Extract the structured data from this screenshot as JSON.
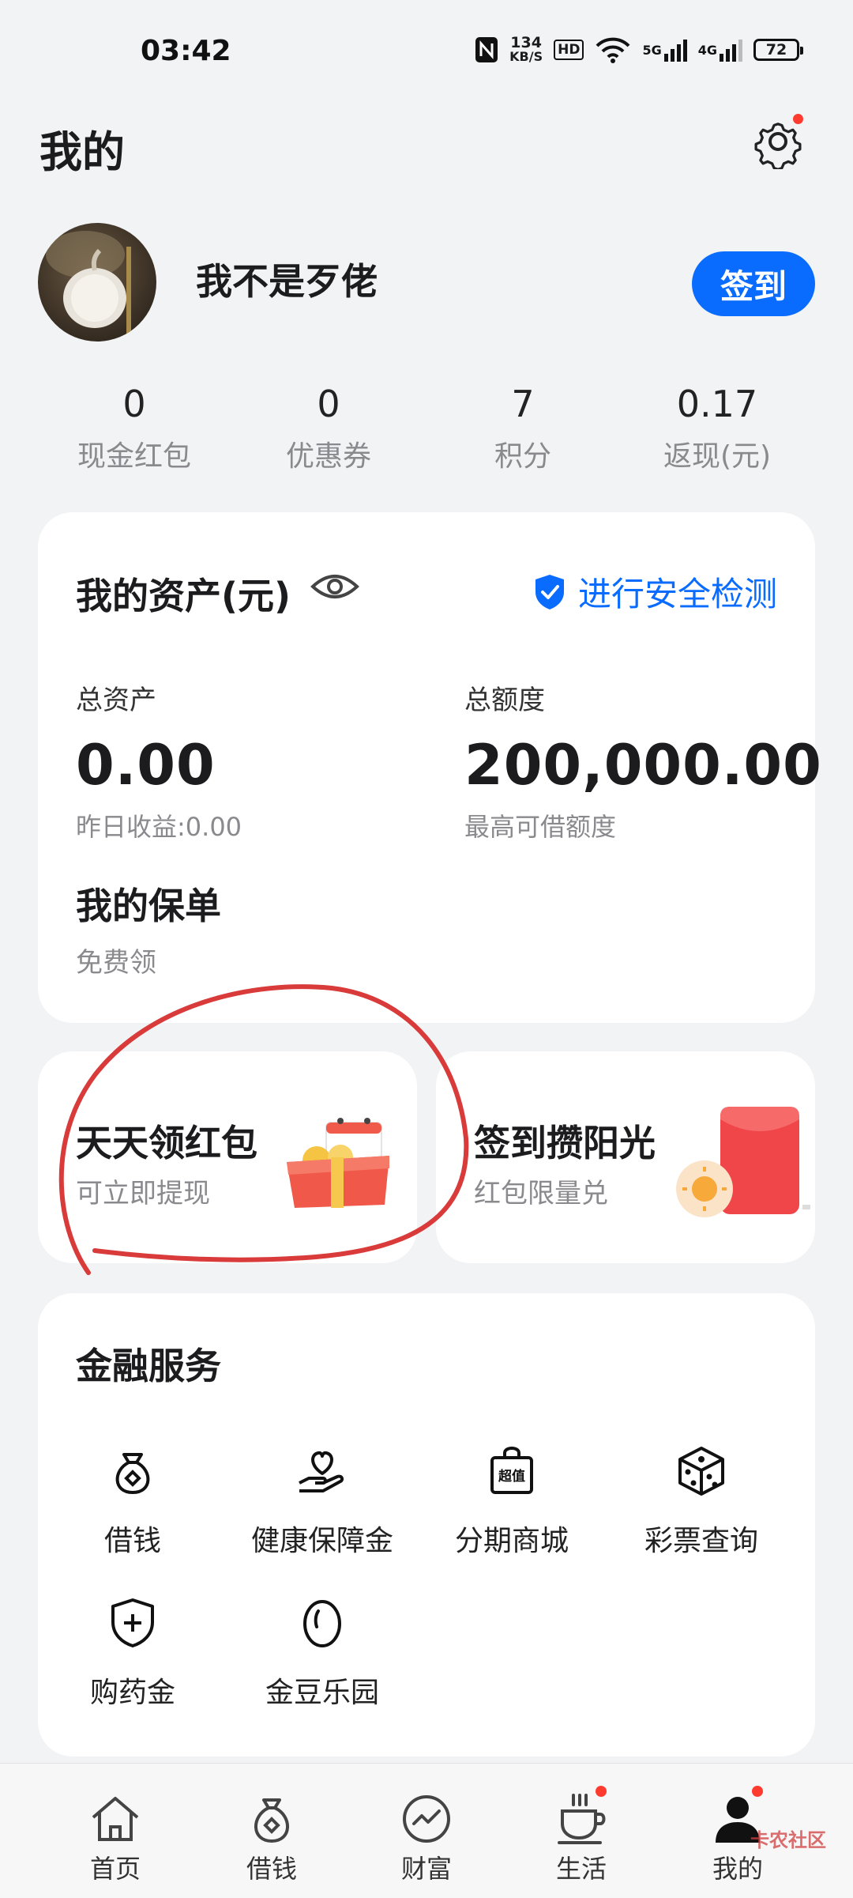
{
  "status_bar": {
    "time": "03:42",
    "net_speed_value": "134",
    "net_speed_unit": "KB/S",
    "hd": "HD",
    "signal_1": "5G",
    "signal_2": "4G",
    "battery": "72"
  },
  "header": {
    "title": "我的",
    "settings_icon": "gear-icon"
  },
  "profile": {
    "username": "我不是歹佬",
    "checkin_label": "签到"
  },
  "stats": [
    {
      "value": "0",
      "label": "现金红包"
    },
    {
      "value": "0",
      "label": "优惠券"
    },
    {
      "value": "7",
      "label": "积分"
    },
    {
      "value": "0.17",
      "label": "返现(元)"
    }
  ],
  "assets": {
    "title": "我的资产(元)",
    "security_label": "进行安全检测",
    "total_assets_label": "总资产",
    "total_assets_value": "0.00",
    "yesterday_income": "昨日收益:0.00",
    "total_credit_label": "总额度",
    "total_credit_value": "200,000.00",
    "credit_hint": "最高可借额度",
    "policy_title": "我的保单",
    "policy_sub": "免费领"
  },
  "promos": [
    {
      "title": "天天领红包",
      "sub": "可立即提现"
    },
    {
      "title": "签到攒阳光",
      "sub": "红包限量兑"
    }
  ],
  "finance": {
    "title": "金融服务",
    "items": [
      {
        "label": "借钱",
        "icon": "money-bag-icon"
      },
      {
        "label": "健康保障金",
        "icon": "heart-hand-icon"
      },
      {
        "label": "分期商城",
        "icon": "shopping-bag-icon",
        "badge": "超值"
      },
      {
        "label": "彩票查询",
        "icon": "dice-icon"
      },
      {
        "label": "购药金",
        "icon": "shield-plus-icon"
      },
      {
        "label": "金豆乐园",
        "icon": "bean-icon"
      }
    ]
  },
  "nav": [
    {
      "label": "首页",
      "icon": "home-icon"
    },
    {
      "label": "借钱",
      "icon": "money-bag-icon"
    },
    {
      "label": "财富",
      "icon": "wealth-chart-icon"
    },
    {
      "label": "生活",
      "icon": "coffee-cup-icon"
    },
    {
      "label": "我的",
      "icon": "profile-icon"
    }
  ],
  "watermark": "卡农社区",
  "colors": {
    "accent": "#0a6cff",
    "background": "#f2f3f5",
    "badge_red": "#ff3b30",
    "annotation": "#d93a3a"
  }
}
